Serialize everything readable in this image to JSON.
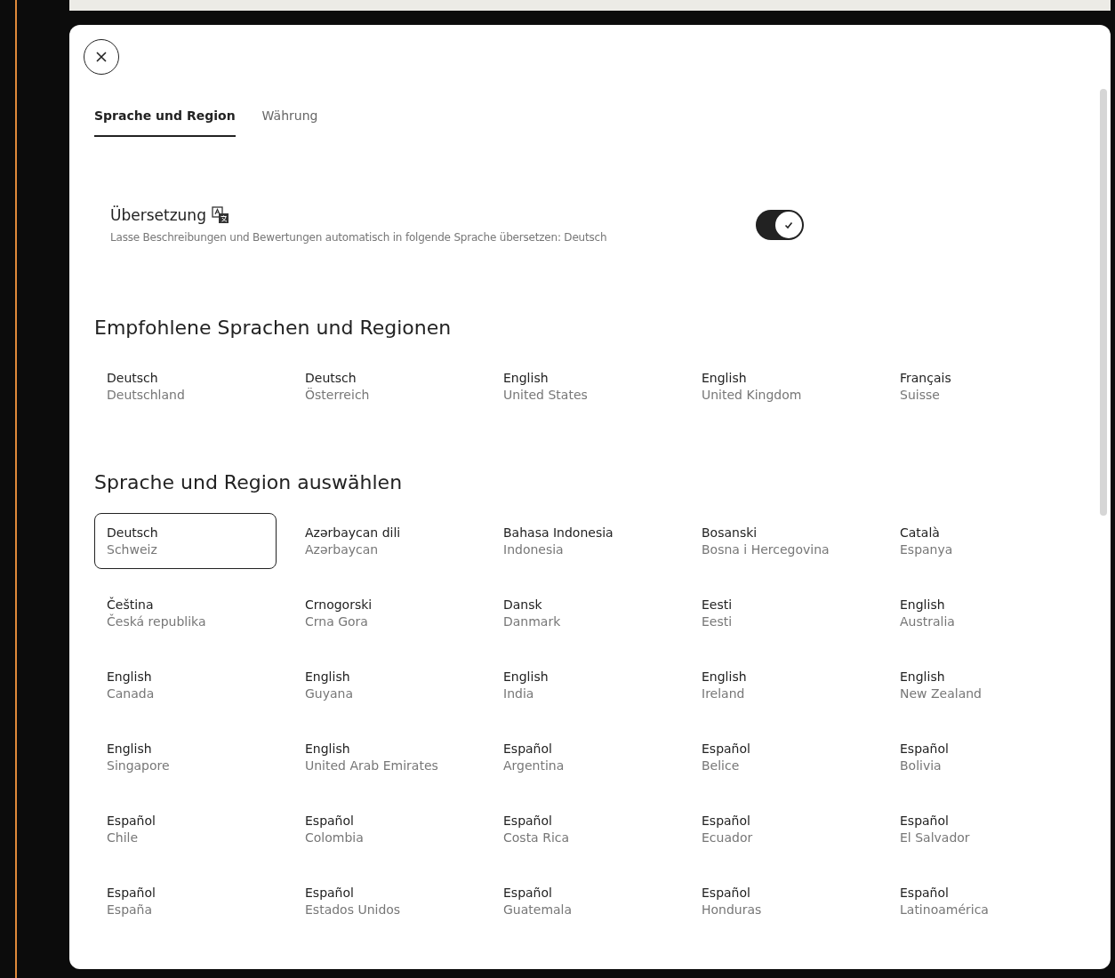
{
  "tabs": [
    {
      "label": "Sprache und Region",
      "selected": true
    },
    {
      "label": "Währung",
      "selected": false
    }
  ],
  "translation": {
    "title": "Übersetzung",
    "description": "Lasse Beschreibungen und Bewertungen automatisch in folgende Sprache übersetzen: Deutsch",
    "on": true
  },
  "recommended": {
    "heading": "Empfohlene Sprachen und Regionen",
    "items": [
      {
        "language": "Deutsch",
        "region": "Deutschland",
        "selected": false
      },
      {
        "language": "Deutsch",
        "region": "Österreich",
        "selected": false
      },
      {
        "language": "English",
        "region": "United States",
        "selected": false
      },
      {
        "language": "English",
        "region": "United Kingdom",
        "selected": false
      },
      {
        "language": "Français",
        "region": "Suisse",
        "selected": false
      }
    ]
  },
  "all": {
    "heading": "Sprache und Region auswählen",
    "items": [
      {
        "language": "Deutsch",
        "region": "Schweiz",
        "selected": true
      },
      {
        "language": "Azərbaycan dili",
        "region": "Azərbaycan",
        "selected": false
      },
      {
        "language": "Bahasa Indonesia",
        "region": "Indonesia",
        "selected": false
      },
      {
        "language": "Bosanski",
        "region": "Bosna i Hercegovina",
        "selected": false
      },
      {
        "language": "Català",
        "region": "Espanya",
        "selected": false
      },
      {
        "language": "Čeština",
        "region": "Česká republika",
        "selected": false
      },
      {
        "language": "Crnogorski",
        "region": "Crna Gora",
        "selected": false
      },
      {
        "language": "Dansk",
        "region": "Danmark",
        "selected": false
      },
      {
        "language": "Eesti",
        "region": "Eesti",
        "selected": false
      },
      {
        "language": "English",
        "region": "Australia",
        "selected": false
      },
      {
        "language": "English",
        "region": "Canada",
        "selected": false
      },
      {
        "language": "English",
        "region": "Guyana",
        "selected": false
      },
      {
        "language": "English",
        "region": "India",
        "selected": false
      },
      {
        "language": "English",
        "region": "Ireland",
        "selected": false
      },
      {
        "language": "English",
        "region": "New Zealand",
        "selected": false
      },
      {
        "language": "English",
        "region": "Singapore",
        "selected": false
      },
      {
        "language": "English",
        "region": "United Arab Emirates",
        "selected": false
      },
      {
        "language": "Español",
        "region": "Argentina",
        "selected": false
      },
      {
        "language": "Español",
        "region": "Belice",
        "selected": false
      },
      {
        "language": "Español",
        "region": "Bolivia",
        "selected": false
      },
      {
        "language": "Español",
        "region": "Chile",
        "selected": false
      },
      {
        "language": "Español",
        "region": "Colombia",
        "selected": false
      },
      {
        "language": "Español",
        "region": "Costa Rica",
        "selected": false
      },
      {
        "language": "Español",
        "region": "Ecuador",
        "selected": false
      },
      {
        "language": "Español",
        "region": "El Salvador",
        "selected": false
      },
      {
        "language": "Español",
        "region": "España",
        "selected": false
      },
      {
        "language": "Español",
        "region": "Estados Unidos",
        "selected": false
      },
      {
        "language": "Español",
        "region": "Guatemala",
        "selected": false
      },
      {
        "language": "Español",
        "region": "Honduras",
        "selected": false
      },
      {
        "language": "Español",
        "region": "Latinoamérica",
        "selected": false
      }
    ]
  }
}
